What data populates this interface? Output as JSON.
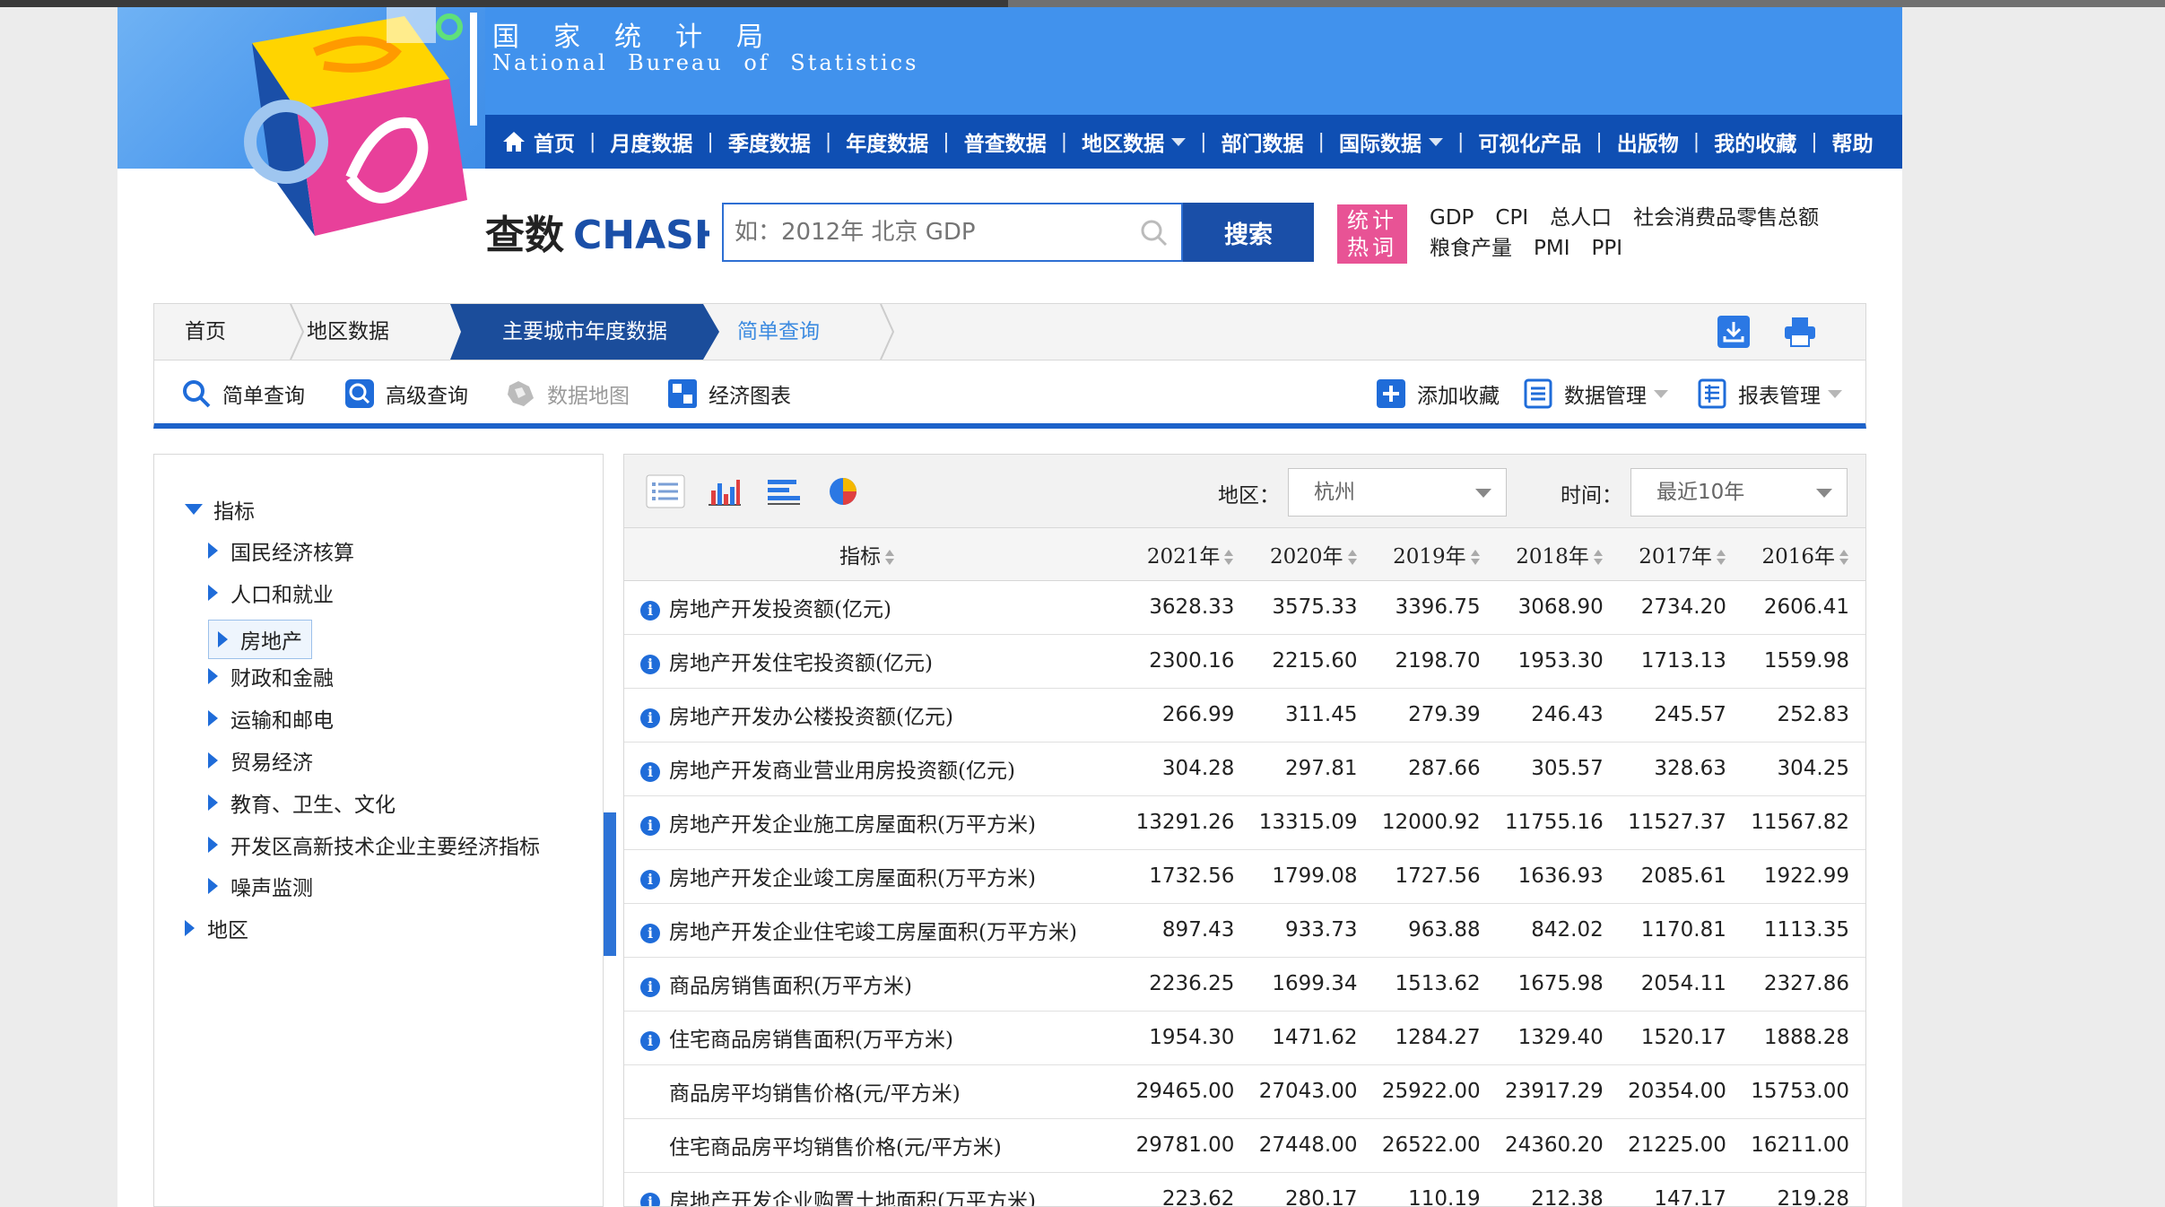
{
  "org": {
    "name_cn": "国家统计局",
    "name_en": "National Bureau of Statistics"
  },
  "nav": [
    {
      "label": "首页",
      "dropdown": false,
      "icon": "home-icon"
    },
    {
      "label": "月度数据",
      "dropdown": false
    },
    {
      "label": "季度数据",
      "dropdown": false
    },
    {
      "label": "年度数据",
      "dropdown": false
    },
    {
      "label": "普查数据",
      "dropdown": false
    },
    {
      "label": "地区数据",
      "dropdown": true
    },
    {
      "label": "部门数据",
      "dropdown": false
    },
    {
      "label": "国际数据",
      "dropdown": true
    },
    {
      "label": "可视化产品",
      "dropdown": false
    },
    {
      "label": "出版物",
      "dropdown": false
    },
    {
      "label": "我的收藏",
      "dropdown": false
    },
    {
      "label": "帮助",
      "dropdown": false
    }
  ],
  "search": {
    "logo_text": "查数CHASHU",
    "logo_cn": "查数",
    "logo_en": "CHASHU",
    "placeholder": "如：2012年 北京 GDP",
    "button": "搜索"
  },
  "hot": {
    "badge_line1": "统计",
    "badge_line2": "热词",
    "words": [
      "GDP",
      "CPI",
      "总人口",
      "社会消费品零售总额",
      "粮食产量",
      "PMI",
      "PPI"
    ]
  },
  "breadcrumb": {
    "home": "首页",
    "region": "地区数据",
    "active": "主要城市年度数据",
    "current": "简单查询"
  },
  "tools": {
    "simple_query": "简单查询",
    "advanced_query": "高级查询",
    "data_map": "数据地图",
    "econ_chart": "经济图表",
    "add_favorite": "添加收藏",
    "data_manage": "数据管理",
    "report_manage": "报表管理"
  },
  "tree": {
    "root": "指标",
    "children": [
      "国民经济核算",
      "人口和就业",
      "房地产",
      "财政和金融",
      "运输和邮电",
      "贸易经济",
      "教育、卫生、文化",
      "开发区高新技术企业主要经济指标",
      "噪声监测"
    ],
    "selected": "房地产",
    "region_root": "地区"
  },
  "filters": {
    "region_label": "地区：",
    "region_value": "杭州",
    "time_label": "时间：",
    "time_value": "最近10年"
  },
  "table": {
    "indicator_header": "指标",
    "years": [
      "2021年",
      "2020年",
      "2019年",
      "2018年",
      "2017年",
      "2016年"
    ],
    "rows": [
      {
        "name": "房地产开发投资额(亿元)",
        "info": true,
        "values": [
          "3628.33",
          "3575.33",
          "3396.75",
          "3068.90",
          "2734.20",
          "2606.41"
        ]
      },
      {
        "name": "房地产开发住宅投资额(亿元)",
        "info": true,
        "values": [
          "2300.16",
          "2215.60",
          "2198.70",
          "1953.30",
          "1713.13",
          "1559.98"
        ]
      },
      {
        "name": "房地产开发办公楼投资额(亿元)",
        "info": true,
        "values": [
          "266.99",
          "311.45",
          "279.39",
          "246.43",
          "245.57",
          "252.83"
        ]
      },
      {
        "name": "房地产开发商业营业用房投资额(亿元)",
        "info": true,
        "values": [
          "304.28",
          "297.81",
          "287.66",
          "305.57",
          "328.63",
          "304.25"
        ]
      },
      {
        "name": "房地产开发企业施工房屋面积(万平方米)",
        "info": true,
        "values": [
          "13291.26",
          "13315.09",
          "12000.92",
          "11755.16",
          "11527.37",
          "11567.82"
        ]
      },
      {
        "name": "房地产开发企业竣工房屋面积(万平方米)",
        "info": true,
        "values": [
          "1732.56",
          "1799.08",
          "1727.56",
          "1636.93",
          "2085.61",
          "1922.99"
        ]
      },
      {
        "name": "房地产开发企业住宅竣工房屋面积(万平方米)",
        "info": true,
        "values": [
          "897.43",
          "933.73",
          "963.88",
          "842.02",
          "1170.81",
          "1113.35"
        ]
      },
      {
        "name": "商品房销售面积(万平方米)",
        "info": true,
        "values": [
          "2236.25",
          "1699.34",
          "1513.62",
          "1675.98",
          "2054.11",
          "2327.86"
        ]
      },
      {
        "name": "住宅商品房销售面积(万平方米)",
        "info": true,
        "values": [
          "1954.30",
          "1471.62",
          "1284.27",
          "1329.40",
          "1520.17",
          "1888.28"
        ]
      },
      {
        "name": "商品房平均销售价格(元/平方米)",
        "info": false,
        "values": [
          "29465.00",
          "27043.00",
          "25922.00",
          "23917.29",
          "20354.00",
          "15753.00"
        ]
      },
      {
        "name": "住宅商品房平均销售价格(元/平方米)",
        "info": false,
        "values": [
          "29781.00",
          "27448.00",
          "26522.00",
          "24360.20",
          "21225.00",
          "16211.00"
        ]
      },
      {
        "name": "房地产开发企业购置土地面积(万平方米)",
        "info": true,
        "values": [
          "223.62",
          "280.17",
          "110.19",
          "212.38",
          "147.17",
          "219.28"
        ]
      }
    ]
  },
  "colors": {
    "banner": "#4192ed",
    "nav": "#0f4fb3",
    "accent": "#1d62c9",
    "hot_badge": "#e85395"
  }
}
